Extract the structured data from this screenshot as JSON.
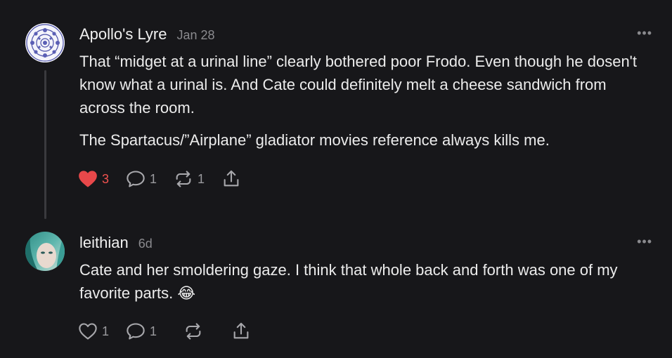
{
  "colors": {
    "background": "#17171a",
    "text": "#ececec",
    "muted": "#8a8a8e",
    "like_active": "#e8484a",
    "thread_line": "#3a3a3e"
  },
  "comments": [
    {
      "author": "Apollo's Lyre",
      "date": "Jan 28",
      "more_label": "•••",
      "paragraphs": [
        "That “midget at a urinal line” clearly bothered poor Frodo. Even though he dosen't know what a urinal is. And Cate could definitely melt a cheese sandwich from across the room.",
        "The Spartacus/”Airplane” gladiator movies reference always kills me."
      ],
      "likes": "3",
      "liked": true,
      "replies": "1",
      "restacks": "1"
    },
    {
      "author": "leithian",
      "date": "6d",
      "more_label": "•••",
      "text": "Cate and her smoldering gaze. I think that whole back and forth was one of my favorite parts.",
      "emoji": "😂",
      "likes": "1",
      "liked": false,
      "replies": "1",
      "restacks": ""
    }
  ]
}
